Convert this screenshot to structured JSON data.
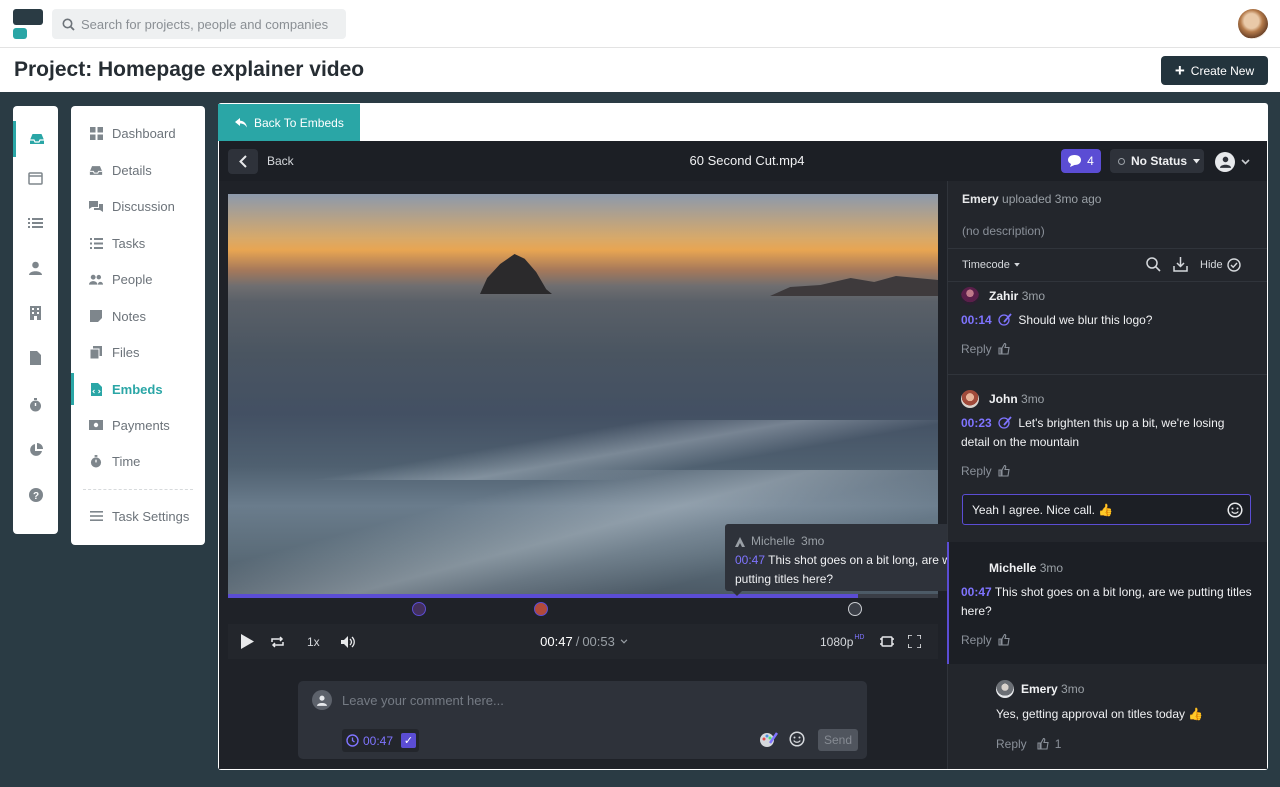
{
  "search": {
    "placeholder": "Search for projects, people and companies"
  },
  "page": {
    "title": "Project: Homepage explainer video",
    "create_label": "Create New"
  },
  "rail": {
    "icons": [
      "inbox-icon",
      "calendar-icon",
      "list-icon",
      "person-icon",
      "building-icon",
      "file-icon",
      "timer-icon",
      "pie-chart-icon",
      "help-icon"
    ]
  },
  "nav": {
    "items": [
      {
        "label": "Dashboard",
        "icon": "dashboard-icon"
      },
      {
        "label": "Details",
        "icon": "inbox-icon"
      },
      {
        "label": "Discussion",
        "icon": "chat-icon"
      },
      {
        "label": "Tasks",
        "icon": "tasks-icon"
      },
      {
        "label": "People",
        "icon": "people-icon"
      },
      {
        "label": "Notes",
        "icon": "note-icon"
      },
      {
        "label": "Files",
        "icon": "files-icon"
      },
      {
        "label": "Embeds",
        "icon": "embed-icon",
        "active": true
      },
      {
        "label": "Payments",
        "icon": "payments-icon"
      },
      {
        "label": "Time",
        "icon": "timer-icon"
      }
    ],
    "settings": "Task Settings"
  },
  "viewer": {
    "back_to_embeds": "Back To Embeds",
    "back": "Back",
    "filename": "60 Second Cut.mp4",
    "comment_count": "4",
    "status": "No Status",
    "accent": "#5b4dd4"
  },
  "player": {
    "current": "00:47",
    "separator": "/",
    "total": "00:53",
    "speed": "1x",
    "quality": "1080p",
    "quality_badge": "HD",
    "progress": 0.887
  },
  "tooltip": {
    "name": "Michelle",
    "ago": "3mo",
    "timecode": "00:47",
    "text": "This shot goes on a bit long, are we putting titles here?"
  },
  "composer": {
    "placeholder": "Leave your comment here...",
    "timestamp": "00:47",
    "send": "Send"
  },
  "sidebar": {
    "uploader": "Emery",
    "uploaded": "uploaded 3mo ago",
    "description": "(no description)",
    "sort": "Timecode",
    "hide": "Hide",
    "comments": [
      {
        "name": "Zahir",
        "ago": "3mo",
        "timecode": "00:14",
        "text": "Should we blur this logo?",
        "reply": "Reply"
      },
      {
        "name": "John",
        "ago": "3mo",
        "timecode": "00:23",
        "text": "Let's brighten this up a bit, we're losing detail on the mountain",
        "reply": "Reply"
      },
      {
        "name": "Michelle",
        "ago": "3mo",
        "timecode": "00:47",
        "text": "This shot goes on a bit long, are we putting titles here?",
        "reply": "Reply"
      }
    ],
    "reply_draft": "Yeah I agree. Nice call. 👍",
    "thread": {
      "name": "Emery",
      "ago": "3mo",
      "text": "Yes, getting approval on titles today 👍",
      "reply": "Reply",
      "likes": "1"
    }
  }
}
